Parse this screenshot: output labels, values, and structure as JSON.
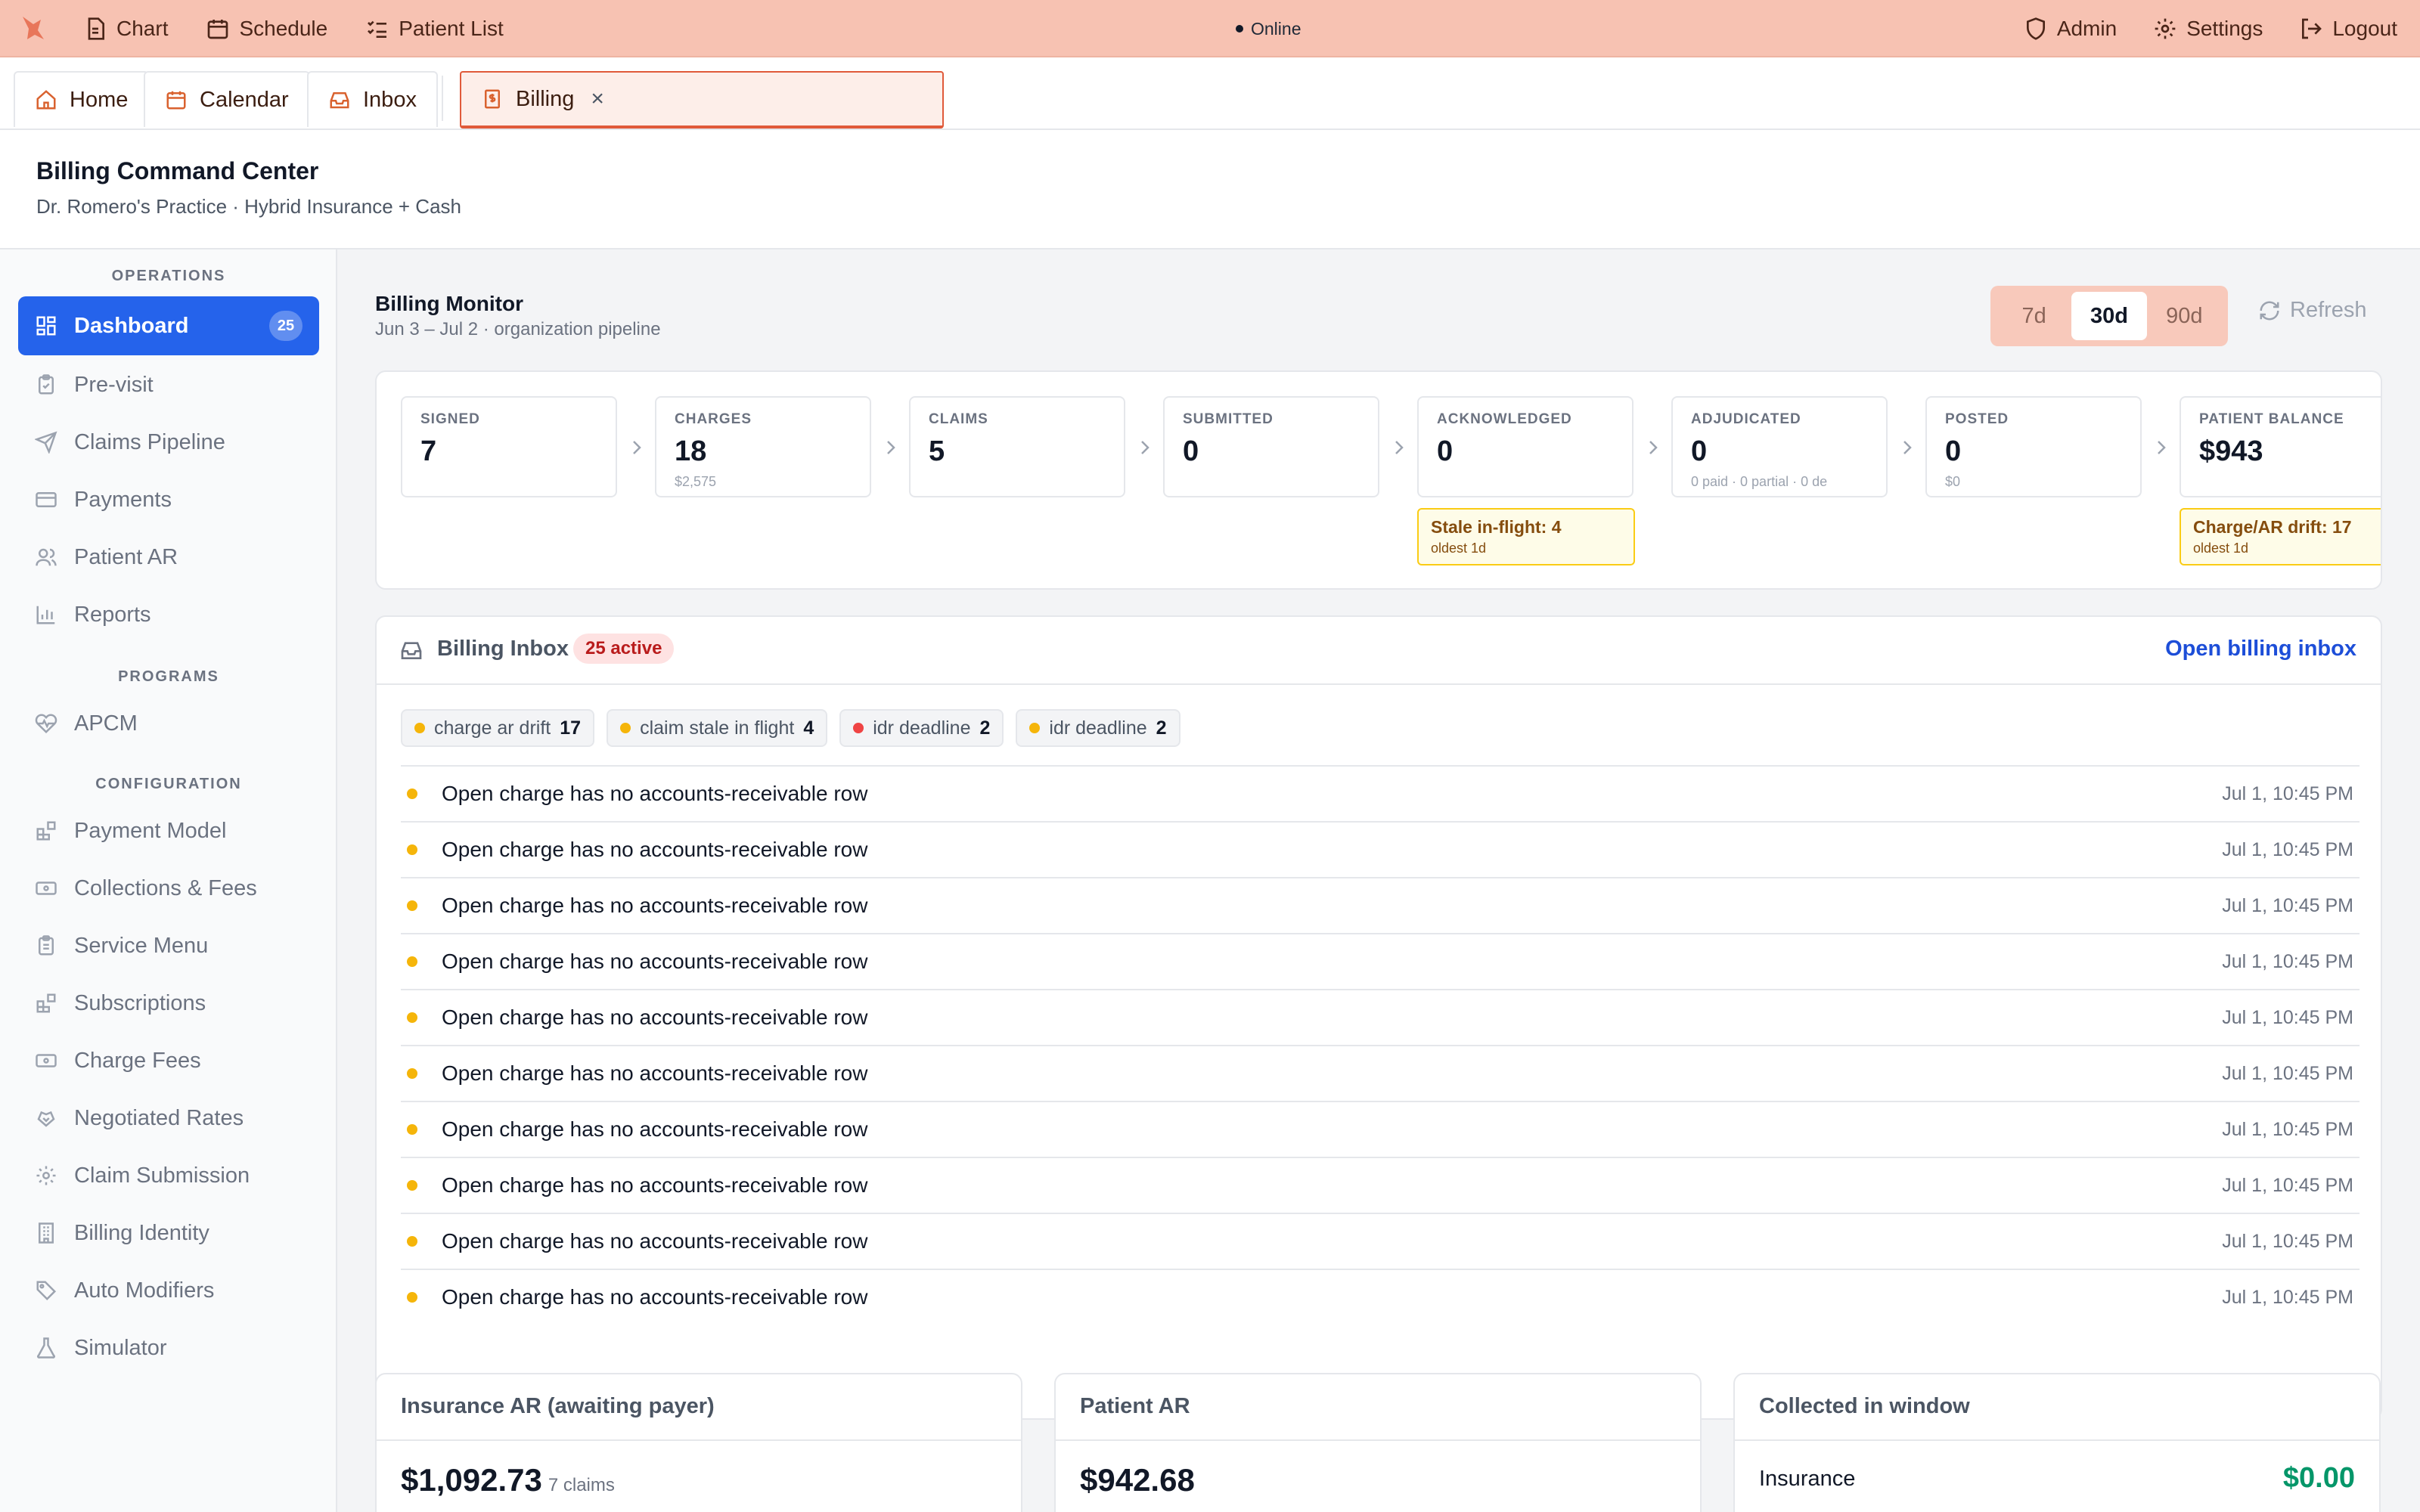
{
  "topbar": {
    "nav": [
      {
        "label": "Chart",
        "icon": "document-icon"
      },
      {
        "label": "Schedule",
        "icon": "calendar-icon"
      },
      {
        "label": "Patient List",
        "icon": "checklist-icon"
      }
    ],
    "status": "Online",
    "right": [
      {
        "label": "Admin",
        "icon": "shield-icon"
      },
      {
        "label": "Settings",
        "icon": "gear-icon"
      },
      {
        "label": "Logout",
        "icon": "logout-icon"
      }
    ],
    "brand_color": "#f7c2b2"
  },
  "tabs": [
    {
      "label": "Home",
      "icon": "home-icon"
    },
    {
      "label": "Calendar",
      "icon": "calendar-icon"
    },
    {
      "label": "Inbox",
      "icon": "inbox-icon"
    },
    {
      "label": "Billing",
      "icon": "billing-icon",
      "active": true
    }
  ],
  "header": {
    "title": "Billing Command Center",
    "subtitle": "Dr. Romero's Practice · Hybrid Insurance + Cash"
  },
  "sidebar": {
    "sections": [
      {
        "title": "OPERATIONS",
        "items": [
          {
            "label": "Dashboard",
            "badge": "25",
            "active": true,
            "icon": "grid-icon"
          },
          {
            "label": "Pre-visit",
            "icon": "clipboard-icon"
          },
          {
            "label": "Claims Pipeline",
            "icon": "send-icon"
          },
          {
            "label": "Payments",
            "icon": "card-icon"
          },
          {
            "label": "Patient AR",
            "icon": "users-icon"
          },
          {
            "label": "Reports",
            "icon": "bar-chart-icon"
          }
        ]
      },
      {
        "title": "PROGRAMS",
        "items": [
          {
            "label": "APCM",
            "icon": "heart-pulse-icon"
          }
        ]
      },
      {
        "title": "CONFIGURATION",
        "items": [
          {
            "label": "Payment Model",
            "icon": "blocks-icon"
          },
          {
            "label": "Collections & Fees",
            "icon": "banknote-icon"
          },
          {
            "label": "Service Menu",
            "icon": "clipboard-list-icon"
          },
          {
            "label": "Subscriptions",
            "icon": "blocks-icon"
          },
          {
            "label": "Charge Fees",
            "icon": "banknote-icon"
          },
          {
            "label": "Negotiated Rates",
            "icon": "handshake-icon"
          },
          {
            "label": "Claim Submission",
            "icon": "gear-icon"
          },
          {
            "label": "Billing Identity",
            "icon": "building-icon"
          },
          {
            "label": "Auto Modifiers",
            "icon": "tags-icon"
          },
          {
            "label": "Simulator",
            "icon": "flask-icon"
          }
        ]
      }
    ]
  },
  "monitor": {
    "title": "Billing Monitor",
    "subtitle": "Jun 3 – Jul 2 · organization pipeline",
    "ranges": [
      "7d",
      "30d",
      "90d"
    ],
    "active_range": "30d",
    "refresh_label": "Refresh"
  },
  "pipeline": [
    {
      "label": "SIGNED",
      "value": "7",
      "note": ""
    },
    {
      "label": "CHARGES",
      "value": "18",
      "note": "$2,575"
    },
    {
      "label": "CLAIMS",
      "value": "5",
      "note": ""
    },
    {
      "label": "SUBMITTED",
      "value": "0",
      "note": ""
    },
    {
      "label": "ACKNOWLEDGED",
      "value": "0",
      "note": "",
      "warning": {
        "title": "Stale in-flight: 4",
        "sub": "oldest 1d"
      }
    },
    {
      "label": "ADJUDICATED",
      "value": "0",
      "note": "0 paid · 0 partial · 0 de"
    },
    {
      "label": "POSTED",
      "value": "0",
      "note": "$0"
    },
    {
      "label": "PATIENT BALANCE",
      "value": "$943",
      "note": "",
      "warning": {
        "title": "Charge/AR drift: 17",
        "sub": "oldest 1d"
      }
    }
  ],
  "inbox": {
    "title": "Billing Inbox",
    "badge": "25 active",
    "link": "Open billing inbox",
    "chips": [
      {
        "label": "charge ar drift",
        "count": "17",
        "color": "#f5b50a"
      },
      {
        "label": "claim stale in flight",
        "count": "4",
        "color": "#f5b50a"
      },
      {
        "label": "idr deadline",
        "count": "2",
        "color": "#ef4444"
      },
      {
        "label": "idr deadline",
        "count": "2",
        "color": "#f5b50a"
      }
    ],
    "rows": [
      {
        "text": "Open charge has no accounts-receivable row",
        "time": "Jul 1, 10:45 PM"
      },
      {
        "text": "Open charge has no accounts-receivable row",
        "time": "Jul 1, 10:45 PM"
      },
      {
        "text": "Open charge has no accounts-receivable row",
        "time": "Jul 1, 10:45 PM"
      },
      {
        "text": "Open charge has no accounts-receivable row",
        "time": "Jul 1, 10:45 PM"
      },
      {
        "text": "Open charge has no accounts-receivable row",
        "time": "Jul 1, 10:45 PM"
      },
      {
        "text": "Open charge has no accounts-receivable row",
        "time": "Jul 1, 10:45 PM"
      },
      {
        "text": "Open charge has no accounts-receivable row",
        "time": "Jul 1, 10:45 PM"
      },
      {
        "text": "Open charge has no accounts-receivable row",
        "time": "Jul 1, 10:45 PM"
      },
      {
        "text": "Open charge has no accounts-receivable row",
        "time": "Jul 1, 10:45 PM"
      },
      {
        "text": "Open charge has no accounts-receivable row",
        "time": "Jul 1, 10:45 PM"
      }
    ]
  },
  "summary": {
    "insurance_ar": {
      "title": "Insurance AR (awaiting payer)",
      "amount": "$1,092.73",
      "count": "7 claims"
    },
    "patient_ar": {
      "title": "Patient AR",
      "amount": "$942.68"
    },
    "collected": {
      "title": "Collected in window",
      "label": "Insurance",
      "amount": "$0.00"
    }
  }
}
